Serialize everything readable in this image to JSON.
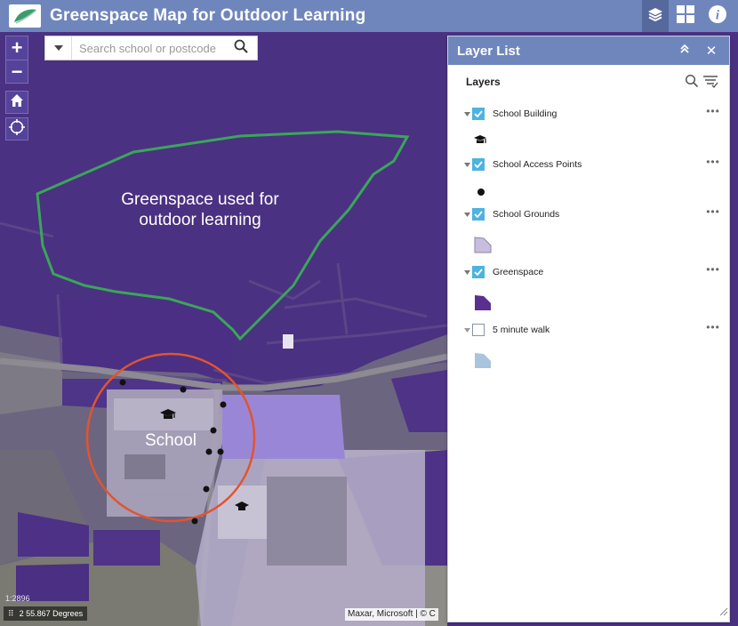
{
  "app": {
    "title": "Greenspace Map for Outdoor Learning"
  },
  "header_buttons": [
    {
      "icon": "layers-icon",
      "active": true
    },
    {
      "icon": "grid-icon",
      "active": false
    },
    {
      "icon": "info-icon",
      "active": false
    }
  ],
  "search": {
    "placeholder": "Search school or postcode"
  },
  "map": {
    "greenspace_label": "Greenspace used for outdoor learning",
    "school_label": "School",
    "scale_text": "1:2896",
    "coordinates": "2 55.867 Degrees",
    "attribution": "Maxar, Microsoft | © C"
  },
  "layer_list": {
    "title": "Layer List",
    "layers_heading": "Layers",
    "layers": [
      {
        "name": "School Building",
        "checked": true,
        "legend": "graduation-cap-icon"
      },
      {
        "name": "School Access Points",
        "checked": true,
        "legend": "black-dot-icon"
      },
      {
        "name": "School Grounds",
        "checked": true,
        "legend": "light-purple-polygon",
        "color": "#c9bddf"
      },
      {
        "name": "Greenspace",
        "checked": true,
        "legend": "purple-polygon",
        "color": "#5b2f8e"
      },
      {
        "name": "5 minute walk",
        "checked": false,
        "legend": "light-blue-polygon",
        "color": "#a9c4dd"
      }
    ]
  },
  "colors": {
    "header": "#6f86bd",
    "checkbox": "#4db3e0",
    "greenspace_outline": "#3aa65a",
    "walk_circle": "#e2542f"
  }
}
